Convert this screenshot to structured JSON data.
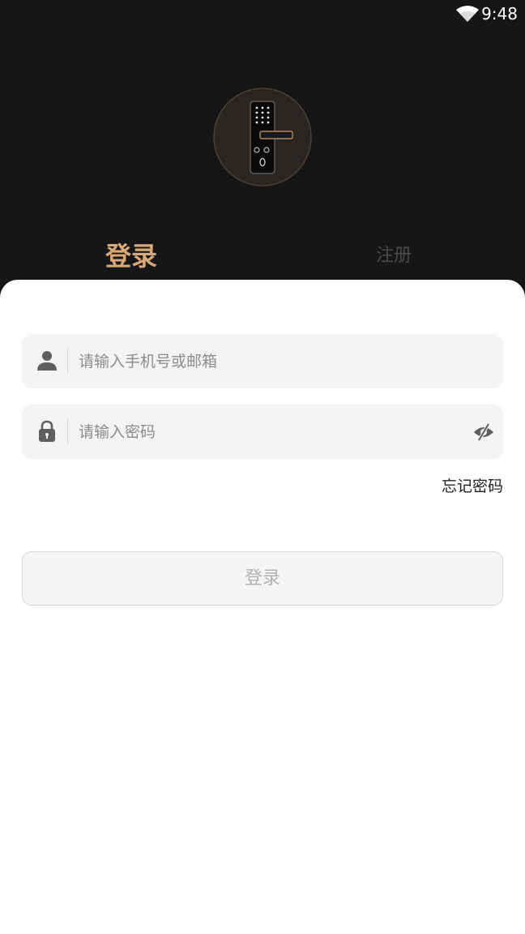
{
  "status_bar": {
    "time": "9:48",
    "wifi_icon": "wifi-icon"
  },
  "header": {
    "logo_icon": "smart-door-lock-icon",
    "tabs": [
      {
        "label": "登录",
        "active": true
      },
      {
        "label": "注册",
        "active": false
      }
    ]
  },
  "form": {
    "account": {
      "icon": "user-icon",
      "placeholder": "请输入手机号或邮箱",
      "value": ""
    },
    "password": {
      "icon": "lock-icon",
      "placeholder": "请输入密码",
      "value": "",
      "toggle_icon": "eye-off-icon"
    },
    "forgot_label": "忘记密码",
    "submit_label": "登录"
  },
  "colors": {
    "header_bg": "#161616",
    "accent": "#d9a878",
    "inactive_tab": "#4a4a4a",
    "field_bg": "#f4f4f4",
    "button_bg": "#f5f5f5",
    "button_text": "#b0b0b0"
  }
}
